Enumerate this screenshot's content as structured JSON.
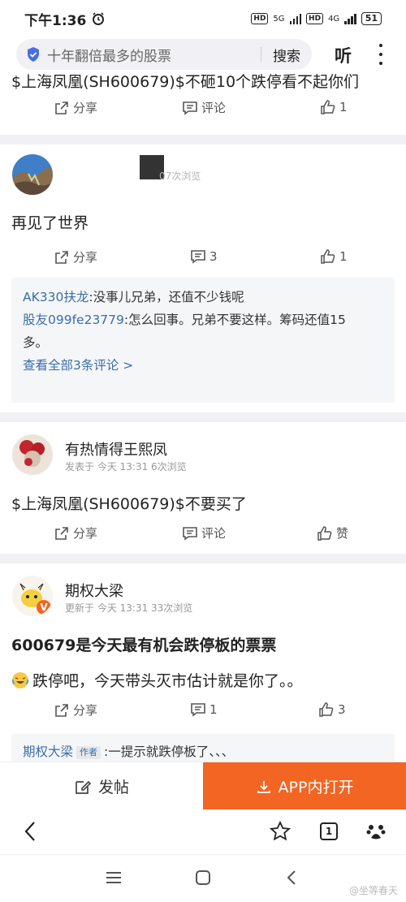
{
  "status_bar": {
    "time": "下午1:36",
    "net1": "5G",
    "net2": "4G",
    "battery": "51"
  },
  "search": {
    "query": "十年翻倍最多的股票",
    "search_label": "搜索",
    "listen_label": "听"
  },
  "posts": [
    {
      "content": "$上海凤凰(SH600679)$不砸10个跌停看不起你们",
      "share": "分享",
      "comment": "评论",
      "likes": "1"
    },
    {
      "meta": "07次浏览",
      "content": "再见了世界",
      "share": "分享",
      "comments_count": "3",
      "likes": "1",
      "comments": [
        {
          "user": "AK330扶龙",
          "text": ":没事儿兄弟，还值不少钱呢"
        },
        {
          "user": "股友099fe23779",
          "text": ":怎么回事。兄弟不要这样。筹码还值15"
        },
        {
          "user": "",
          "text": "多。"
        }
      ],
      "view_all": "查看全部3条评论 >"
    },
    {
      "user": "有热情得王熙凤",
      "meta": "发表于 今天 13:31   6次浏览",
      "content": "$上海凤凰(SH600679)$不要买了",
      "share": "分享",
      "comment": "评论",
      "like": "赞"
    },
    {
      "user": "期权大梁",
      "meta": "更新于 今天 13:31   33次浏览",
      "title": "600679是今天最有机会跌停板的票票",
      "content": "跌停吧，今天带头灭市估计就是你了。。",
      "share": "分享",
      "comments_count": "1",
      "likes": "3",
      "comment_user": "期权大梁",
      "author_tag": "作者",
      "comment_text": ":一提示就跌停板了、、、"
    }
  ],
  "bottom": {
    "post_label": "发帖",
    "app_label": "APP内打开"
  },
  "browser": {
    "tab_count": "1"
  },
  "watermark": "@坐等春天",
  "colors": {
    "accent": "#f26522",
    "link": "#3b6ea8"
  }
}
